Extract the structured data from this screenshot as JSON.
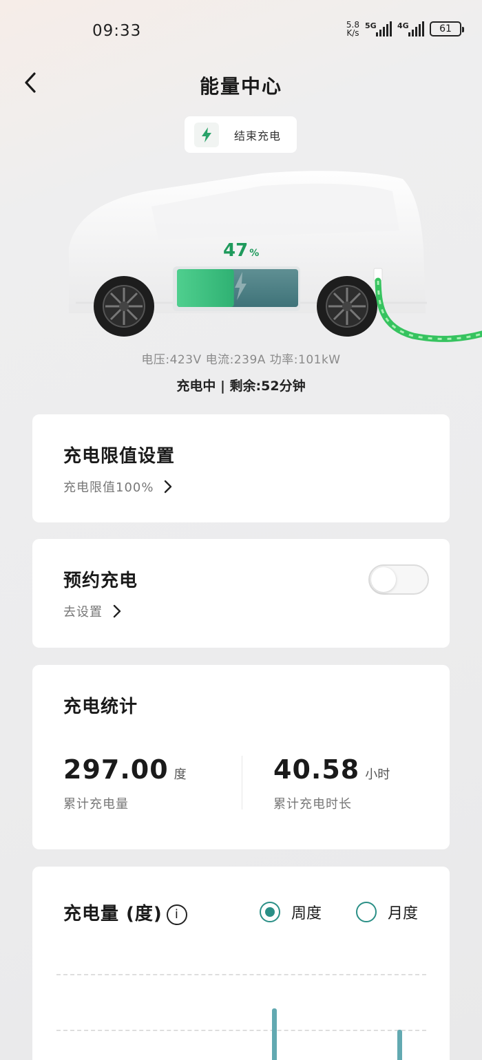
{
  "status_bar": {
    "time": "09:33",
    "net_speed_value": "5.8",
    "net_speed_unit": "K/s",
    "sig1_label": "5G",
    "sig2_label": "4G",
    "battery": "61"
  },
  "header": {
    "title": "能量中心",
    "stop_charging_label": "结束充电"
  },
  "charging": {
    "percent_value": "47",
    "percent_sign": "%",
    "battery_level": 0.47,
    "stats": "电压:423V 电流:239A 功率:101kW",
    "status": "充电中 | 剩余:52分钟"
  },
  "limit_card": {
    "title": "充电限值设置",
    "subtitle": "充电限值100%"
  },
  "schedule_card": {
    "title": "预约充电",
    "subtitle": "去设置",
    "toggle_on": false
  },
  "stats_card": {
    "title": "充电统计",
    "energy_value": "297.00",
    "energy_unit": "度",
    "energy_label": "累计充电量",
    "duration_value": "40.58",
    "duration_unit": "小时",
    "duration_label": "累计充电时长"
  },
  "chart_card": {
    "title": "充电量 (度)",
    "option_week": "周度",
    "option_month": "月度",
    "selected": "周度"
  },
  "colors": {
    "accent_green": "#1f9a5c",
    "teal": "#2a8f86",
    "bar": "#62a9b1"
  }
}
